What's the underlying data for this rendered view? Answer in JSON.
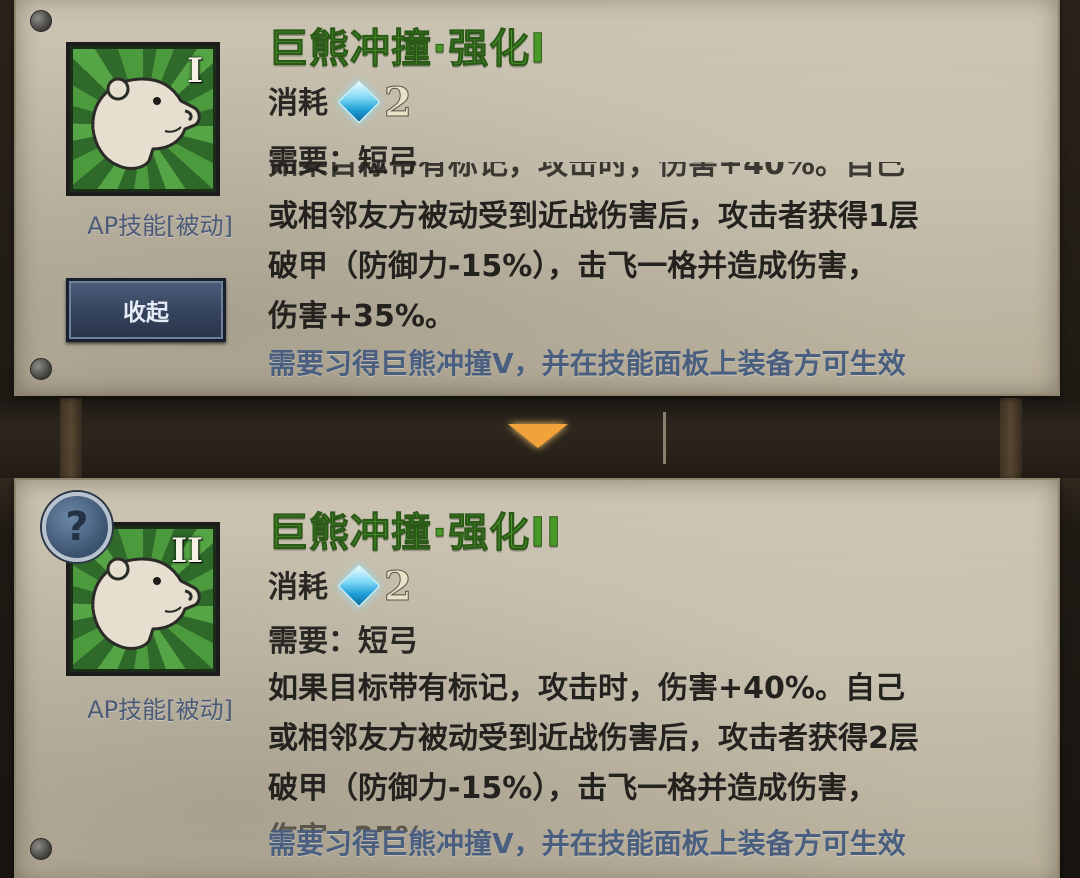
{
  "skills": [
    {
      "title": "巨熊冲撞·强化I",
      "roman": "I",
      "type_label": "AP技能[被动]",
      "cost_label": "消耗",
      "cost_value": "2",
      "requirement": "需要：短弓",
      "desc_cut": "如果目标带有标记，攻击时，伤害+40%。自己",
      "desc_lines": [
        "或相邻友方被动受到近战伤害后，攻击者获得1层",
        "破甲（防御力-15%），击飞一格并造成伤害，",
        "伤害+35%。"
      ],
      "note": "需要习得巨熊冲撞V，并在技能面板上装备方可生效",
      "button_label": "收起"
    },
    {
      "title": "巨熊冲撞·强化II",
      "roman": "II",
      "type_label": "AP技能[被动]",
      "cost_label": "消耗",
      "cost_value": "2",
      "requirement": "需要：短弓",
      "desc_lines": [
        "如果目标带有标记，攻击时，伤害+40%。自己",
        "或相邻友方被动受到近战伤害后，攻击者获得2层",
        "破甲（防御力-15%），击飞一格并造成伤害，"
      ],
      "desc_cut": "伤害+35%。",
      "note": "需要习得巨熊冲撞V，并在技能面板上装备方可生效",
      "help_label": "?"
    }
  ],
  "icons": {
    "cost": "crystal-gem-icon",
    "skill": "bear-icon",
    "help": "question-icon"
  },
  "colors": {
    "title": "#4a9a2a",
    "note": "#4a5f80",
    "button": "#34425c"
  }
}
